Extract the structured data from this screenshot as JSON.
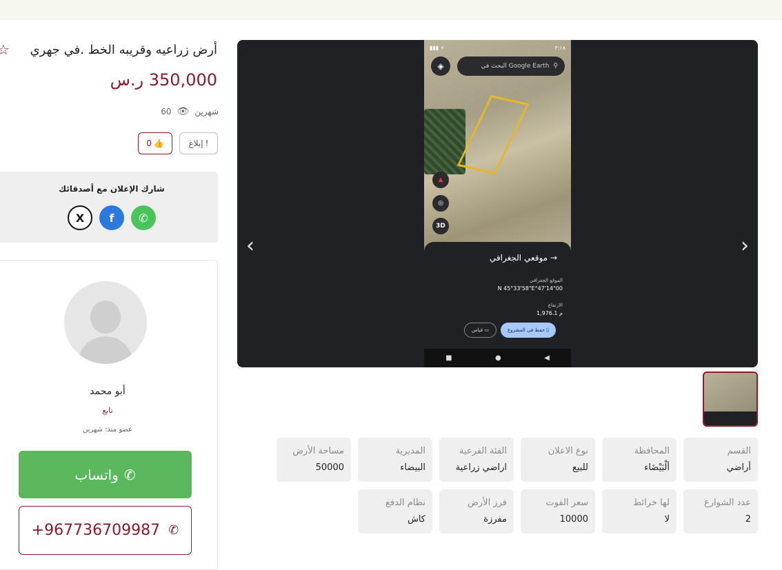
{
  "listing": {
    "title": "أرض زراعيه وقريبه الخط .في جهري",
    "price": "350,000 ر.س",
    "posted": "شهرين",
    "views": "60",
    "report_label": "إبلاغ",
    "likes": "0"
  },
  "share": {
    "title": "شارك الإعلان مع أصدقائك",
    "x_icon": "X",
    "fb_icon": "f",
    "wa_icon": "✆"
  },
  "seller": {
    "name": "أبو محمد",
    "follow_label": "تابع",
    "member_since": "عضو منذ: شهرين",
    "whatsapp_label": "واتساب",
    "phone": "+967736709987"
  },
  "gallery": {
    "screenshot": {
      "time": "٣:١٨",
      "search_placeholder": "البحث في Google Earth",
      "panel_title": "موقعي الجغرافي",
      "location_label": "الموقع الجغرافي",
      "coords": "N 45°33'58\"E°47'14\"00",
      "altitude_label": "الارتفاع",
      "altitude": "1,976.1 م",
      "save_label": "حفظ في المشروع",
      "measure_label": "قياس",
      "btn_3d": "3D"
    }
  },
  "details": [
    {
      "label": "القسم",
      "value": "أراضي"
    },
    {
      "label": "المحافظة",
      "value": "ألْبَيْضَاء"
    },
    {
      "label": "نوع الاعلان",
      "value": "للبيع"
    },
    {
      "label": "الفئة الفرعية",
      "value": "اراضي زراعية"
    },
    {
      "label": "المديرية",
      "value": "البيضاء"
    },
    {
      "label": "مساحة الأرض",
      "value": "50000"
    },
    {
      "label": "عدد الشوارع",
      "value": "2"
    },
    {
      "label": "لها خرائط",
      "value": "لا"
    },
    {
      "label": "سعر الفوت",
      "value": "10000"
    },
    {
      "label": "فرز الأرض",
      "value": "مفرزة"
    },
    {
      "label": "نظام الدفع",
      "value": "كاش"
    }
  ],
  "colors": {
    "brand": "#8b1a2b",
    "whatsapp": "#5cb85c",
    "facebook": "#2b79e0"
  }
}
